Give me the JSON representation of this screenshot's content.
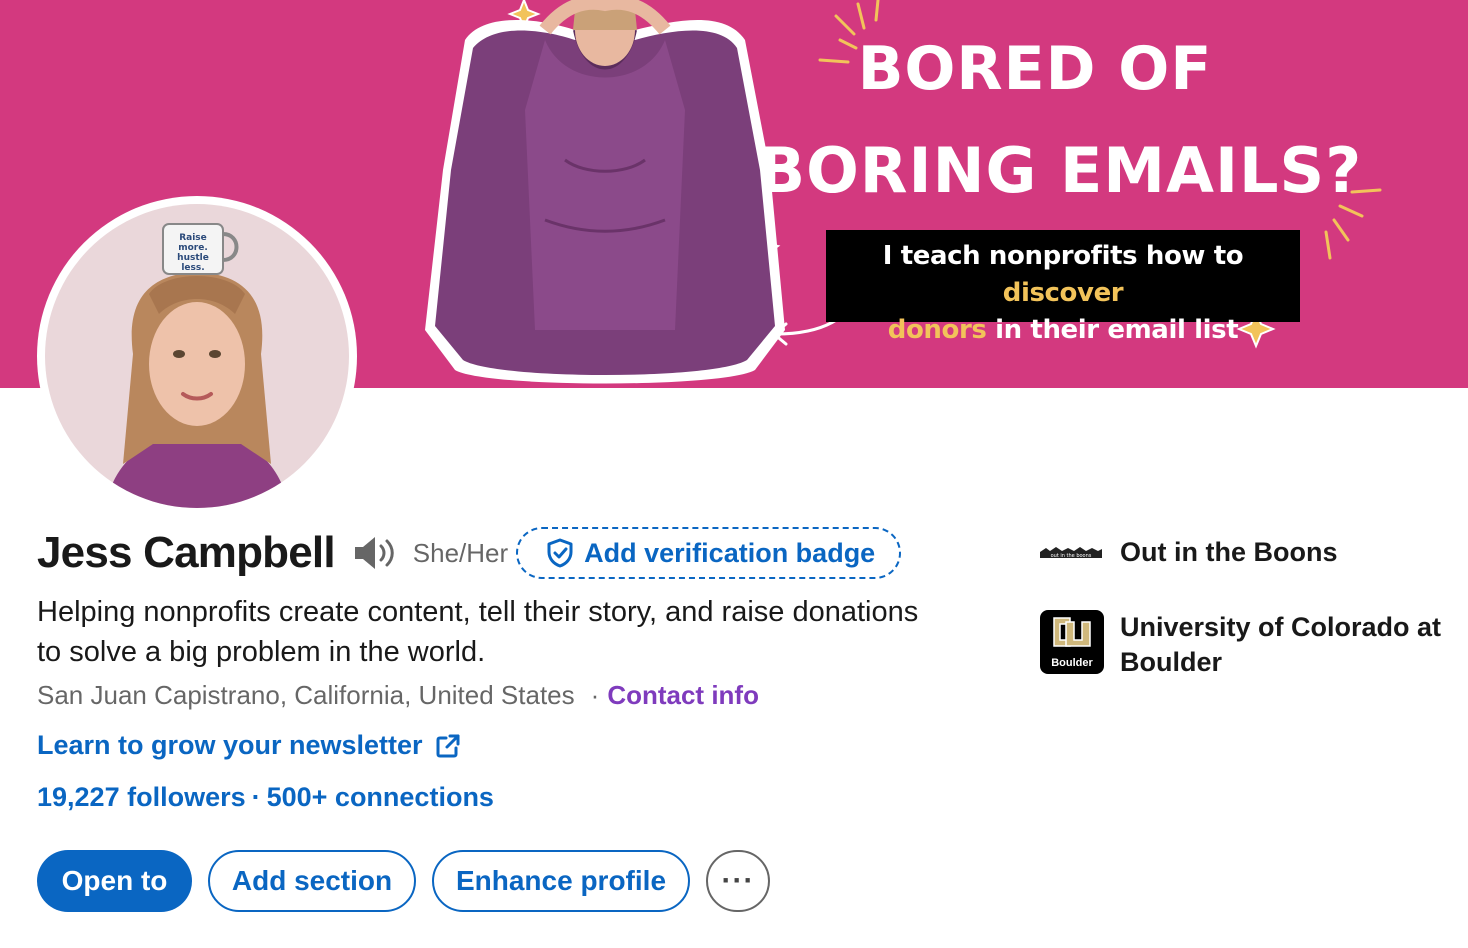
{
  "banner": {
    "headline_line1": "BORED OF",
    "headline_line2": "BORING EMAILS?",
    "caption_part1": "I teach nonprofits how to ",
    "caption_highlight1": "discover",
    "caption_highlight2": "donors",
    "caption_part2": " in their email list",
    "background_color": "#d3397f",
    "mug_text": "Raise more. hustle less."
  },
  "profile": {
    "name": "Jess Campbell",
    "pronouns": "She/Her",
    "verification_label": "Add verification badge",
    "headline": "Helping nonprofits create content, tell their story, and raise donations to solve a big problem in the world.",
    "location": "San Juan Capistrano, California, United States",
    "location_separator": "·",
    "contact_label": "Contact info",
    "newsletter_label": "Learn to grow your newsletter",
    "followers": "19,227 followers",
    "stats_separator": "·",
    "connections": "500+ connections"
  },
  "actions": {
    "open_to": "Open to",
    "add_section": "Add section",
    "enhance_profile": "Enhance profile",
    "more": "···"
  },
  "organizations": [
    {
      "name": "Out in the Boons",
      "logo_text": "out in the boons",
      "icon": "company-logo"
    },
    {
      "name": "University of Colorado at Boulder",
      "logo_text": "Boulder",
      "icon": "university-logo"
    }
  ],
  "colors": {
    "link_blue": "#0a66c2",
    "contact_purple": "#7f3bbd",
    "highlight_yellow": "#f2c35a"
  },
  "icons": {
    "pronunciation": "speaker-icon",
    "verification": "shield-check-icon",
    "external": "external-link-icon"
  }
}
